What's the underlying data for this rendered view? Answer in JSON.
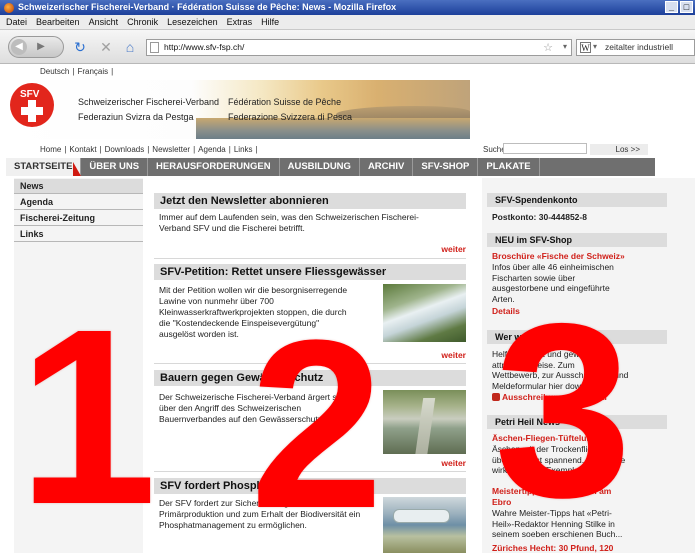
{
  "window": {
    "title": "Schweizerischer Fischerei-Verband · Fédération Suisse de Pêche: News - Mozilla Firefox",
    "minimize": "_",
    "maximize": "□"
  },
  "menubar": [
    "Datei",
    "Bearbeiten",
    "Ansicht",
    "Chronik",
    "Lesezeichen",
    "Extras",
    "Hilfe"
  ],
  "navbar": {
    "url": "http://www.sfv-fsp.ch/",
    "search_engine": "W",
    "search_value": "zeitalter industriell"
  },
  "site": {
    "languages": [
      "Deutsch",
      "Français"
    ],
    "org_names": {
      "de": "Schweizerischer Fischerei-Verband",
      "fr": "Fédération Suisse de Pêche",
      "rm": "Federaziun Svizra da Pestga",
      "it": "Federazione Svizzera di Pesca"
    },
    "logo_text": "SFV",
    "top_links": [
      "Home",
      "Kontakt",
      "Downloads",
      "Newsletter",
      "Agenda",
      "Links"
    ],
    "search_label": "Suche:",
    "search_button": "Los >>",
    "tabs": [
      "STARTSEITE",
      "ÜBER UNS",
      "HERAUSFORDERUNGEN",
      "AUSBILDUNG",
      "ARCHIV",
      "SFV-SHOP",
      "PLAKATE"
    ],
    "sidebar": [
      "News",
      "Agenda",
      "Fischerei-Zeitung",
      "Links"
    ]
  },
  "main": {
    "sections": [
      {
        "title": "Jetzt den Newsletter abonnieren",
        "lines": [
          "Immer auf dem Laufenden sein, was den Schweizerischen Fischerei-",
          "Verband SFV und die Fischerei betrifft."
        ],
        "more": "weiter"
      },
      {
        "title": "SFV-Petition: Rettet unsere Fliessgewässer",
        "lines": [
          "Mit der Petition wollen wir die besorgniserregende",
          "Lawine von nunmehr über 700",
          "Kleinwasserkraftwerkprojekten stoppen, die durch",
          "die \"Kostendeckende Einspeisevergütung\"",
          "ausgelöst worden ist."
        ],
        "more": "weiter"
      },
      {
        "title": "Bauern gegen Gewässerschutz",
        "lines": [
          "Der Schweizerische Fischerei-Verband ärgert sich",
          "über den Angriff des Schweizerischen",
          "Bauernverbandes auf den Gewässerschutz."
        ],
        "more": "weiter"
      },
      {
        "title": "SFV fordert Phosphatmanagement",
        "lines": [
          "Der SFV fordert zur Sicherstellung der",
          "Primärproduktion und zum Erhalt der Biodiversität ein",
          "Phosphatmanagement zu ermöglichen."
        ]
      }
    ]
  },
  "right": {
    "spenden_title": "SFV-Spendenkonto",
    "postkonto": "Postkonto:  30-444852-8",
    "shop_title": "NEU im SFV-Shop",
    "shop_link": "Broschüre «Fische der Schweiz»",
    "shop_lines": [
      "Infos über alle 46 einheimischen",
      "Fischarten sowie über",
      "ausgestorbene und eingeführte",
      "Arten."
    ],
    "shop_more": "Details",
    "quiz_title": "Wer weiss noch mehr?",
    "quiz_lines": [
      "Helfen Sie mit und gewinnen Sie",
      "attraktive Preise. Zum",
      "Wettbewerb, zur Ausschreibung und",
      "Meldeformular hier downloaden:"
    ],
    "quiz_link": "Ausschreibung / Formular",
    "news_title": "Petri Heil News",
    "news_link1": "Äschen-Fliegen-Tüftelung",
    "news_lines1": [
      "Äschen mit der Trockenfliege zu",
      "überlisten, ist spannend. Um an die",
      "wirklich guten Exemplare..."
    ],
    "news_link2a": "Meistertipps: Welsfischen am",
    "news_link2b": "Ebro",
    "news_lines2": [
      "Wahre Meister-Tipps hat «Petri-",
      "Heil»-Redaktor Henning Stilke in",
      "seinem soeben erschienen Buch..."
    ],
    "news_link3": "Züriches Hecht: 30 Pfund, 120"
  },
  "overlay": {
    "n1": "1",
    "n2": "2",
    "n3": "3",
    "color": "#ff0000"
  }
}
